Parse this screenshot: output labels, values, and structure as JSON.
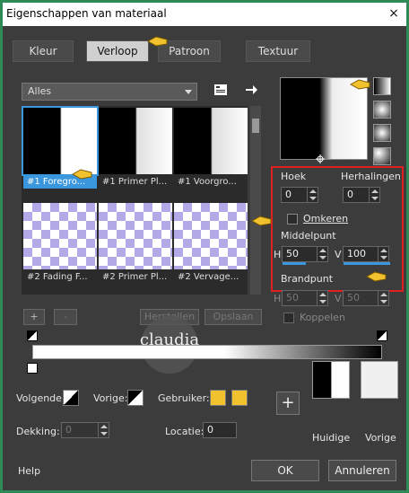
{
  "window": {
    "title": "Eigenschappen van materiaal",
    "close_glyph": "×"
  },
  "tabs": [
    {
      "label": "Kleur"
    },
    {
      "label": "Verloop"
    },
    {
      "label": "Patroon"
    },
    {
      "label": "Textuur"
    }
  ],
  "category_dropdown": {
    "value": "Alles"
  },
  "gradients": [
    {
      "label": "#1 Foregro..."
    },
    {
      "label": "#1 Primer Pl..."
    },
    {
      "label": "#1 Voorgro..."
    },
    {
      "label": "#2 Fading F..."
    },
    {
      "label": "#2 Primer Pl..."
    },
    {
      "label": "#2 Vervage..."
    }
  ],
  "settings": {
    "hoek_label": "Hoek",
    "hoek_value": "0",
    "herhalingen_label": "Herhalingen",
    "herhalingen_value": "0",
    "omkeren_label": "Omkeren",
    "middelpunt_label": "Middelpunt",
    "h_label": "H",
    "h_value": "50",
    "v_label": "V",
    "v_value": "100",
    "brandpunt_label": "Brandpunt",
    "bh_label": "H",
    "bh_value": "50",
    "bv_label": "V",
    "bv_value": "50",
    "koppelen_label": "Koppelen"
  },
  "editor": {
    "add_label": "+",
    "remove_label": "-",
    "herstellen_label": "Herstellen",
    "opslaan_label": "Opslaan"
  },
  "stops": {
    "volgende_label": "Volgende:",
    "vorige_label": "Vorige:",
    "gebruiker_label": "Gebruiker:",
    "dekking_label": "Dekking:",
    "dekking_value": "0",
    "locatie_label": "Locatie:",
    "locatie_value": "0"
  },
  "bottom": {
    "plus_label": "+",
    "huidige_label": "Huidige",
    "vorige_label": "Vorige",
    "help_label": "Help",
    "ok_label": "OK",
    "cancel_label": "Annuleren"
  },
  "colors": {
    "accent": "#3a96dd",
    "highlight_box": "#e02020",
    "user_color": "#f2c12e",
    "frame": "#2e8b57"
  },
  "icons": [
    "close-icon",
    "library-icon",
    "arrow-right-icon",
    "hand-pointer-icon",
    "crosshair-icon"
  ]
}
